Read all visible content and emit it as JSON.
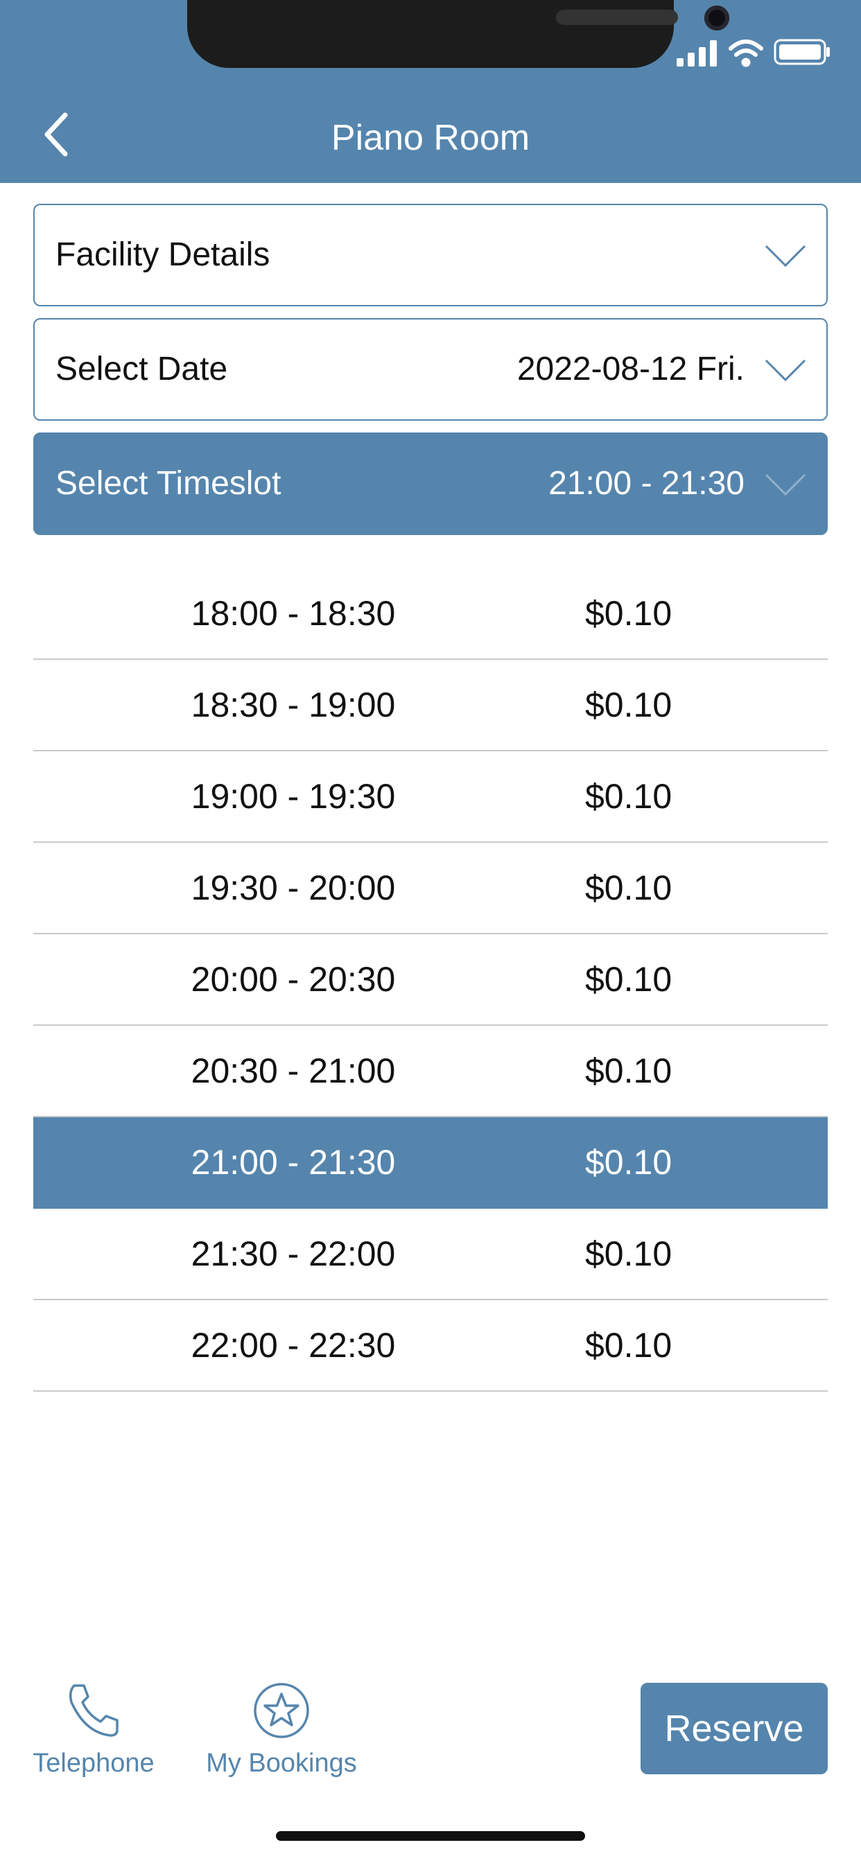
{
  "header": {
    "title": "Piano Room",
    "color": "#5585ad"
  },
  "facility_details": {
    "label": "Facility Details"
  },
  "select_date": {
    "label": "Select Date",
    "value": "2022-08-12 Fri."
  },
  "select_timeslot": {
    "label": "Select Timeslot",
    "value": "21:00 - 21:30"
  },
  "slots": [
    {
      "time": "18:00 - 18:30",
      "price": "$0.10",
      "selected": false
    },
    {
      "time": "18:30 - 19:00",
      "price": "$0.10",
      "selected": false
    },
    {
      "time": "19:00 - 19:30",
      "price": "$0.10",
      "selected": false
    },
    {
      "time": "19:30 - 20:00",
      "price": "$0.10",
      "selected": false
    },
    {
      "time": "20:00 - 20:30",
      "price": "$0.10",
      "selected": false
    },
    {
      "time": "20:30 - 21:00",
      "price": "$0.10",
      "selected": false
    },
    {
      "time": "21:00 - 21:30",
      "price": "$0.10",
      "selected": true
    },
    {
      "time": "21:30 - 22:00",
      "price": "$0.10",
      "selected": false
    },
    {
      "time": "22:00 - 22:30",
      "price": "$0.10",
      "selected": false
    }
  ],
  "tabbar": {
    "telephone": {
      "label": "Telephone",
      "icon": "phone-icon"
    },
    "my_bookings": {
      "label": "My Bookings",
      "icon": "star-icon"
    }
  },
  "reserve": {
    "label": "Reserve"
  }
}
